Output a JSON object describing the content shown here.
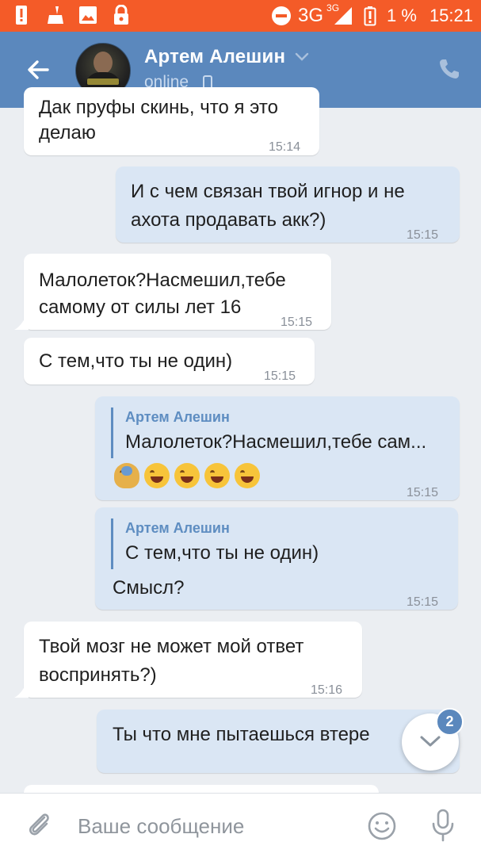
{
  "status_bar": {
    "network": "3G",
    "network_sup": "3G",
    "battery": "1 %",
    "time": "15:21",
    "color": "#f45b28"
  },
  "header": {
    "contact_name": "Артем Алешин",
    "status": "online",
    "color": "#5b88bd"
  },
  "messages": [
    {
      "direction": "in",
      "text_top": "Дак пруфы скинь, что я это",
      "text": "делаю",
      "time": "15:14"
    },
    {
      "direction": "out",
      "line1": "И с чем связан твой игнор и не",
      "line2": "ахота продавать акк?)",
      "time": "15:15"
    },
    {
      "direction": "in",
      "line1": "Малолеток?Насмешил,тебе",
      "line2": "самому от силы лет 16",
      "time": "15:15"
    },
    {
      "direction": "in",
      "text": "С тем,что ты не один)",
      "time": "15:15"
    },
    {
      "direction": "out",
      "reply_name": "Артем Алешин",
      "reply_text": "Малолеток?Насмешил,тебе сам...",
      "emojis": [
        "facepalm",
        "rofl",
        "rofl",
        "rofl",
        "rofl"
      ],
      "time": "15:15"
    },
    {
      "direction": "out",
      "reply_name": "Артем Алешин",
      "reply_text": "С тем,что ты не один)",
      "text": "Смысл?",
      "time": "15:15"
    },
    {
      "direction": "in",
      "line1": "Твой мозг не может мой ответ",
      "line2": "воспринять?)",
      "time": "15:16"
    },
    {
      "direction": "out",
      "text": "Ты что мне пытаешься втере"
    }
  ],
  "scroll_button": {
    "badge": "2"
  },
  "composer": {
    "placeholder": "Ваше сообщение"
  }
}
